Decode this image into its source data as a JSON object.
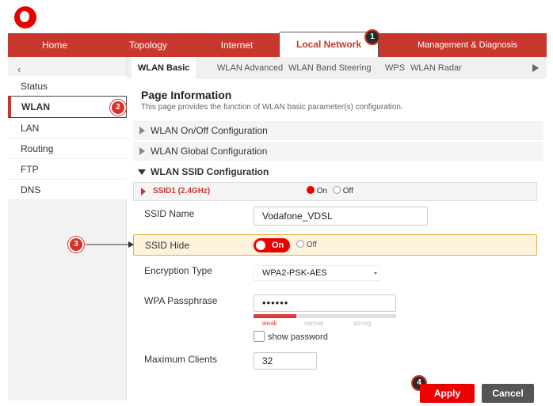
{
  "main_nav": {
    "items": [
      {
        "label": "Home"
      },
      {
        "label": "Topology"
      },
      {
        "label": "Internet"
      },
      {
        "label": "Local Network"
      },
      {
        "label": "Management & Diagnosis"
      }
    ],
    "active": "Local Network"
  },
  "markers": [
    "1",
    "2",
    "3",
    "4"
  ],
  "sidebar": {
    "back": "‹",
    "items": [
      {
        "label": "Status"
      },
      {
        "label": "WLAN"
      },
      {
        "label": "LAN"
      },
      {
        "label": "Routing"
      },
      {
        "label": "FTP"
      },
      {
        "label": "DNS"
      }
    ],
    "active": "WLAN"
  },
  "sub_tabs": {
    "items": [
      {
        "label": "WLAN Basic"
      },
      {
        "label": "WLAN Advanced"
      },
      {
        "label": "WLAN Band Steering"
      },
      {
        "label": "WPS"
      },
      {
        "label": "WLAN Radar"
      }
    ],
    "active": "WLAN Basic"
  },
  "page": {
    "title": "Page Information",
    "description": "This page provides the function of WLAN basic parameter(s) configuration."
  },
  "sections": {
    "onoff": "WLAN On/Off Configuration",
    "global": "WLAN Global Configuration",
    "ssid": "WLAN SSID Configuration"
  },
  "ssid1": {
    "label": "SSID1 (2.4GHz)",
    "on_label": "On",
    "off_label": "Off",
    "selected": "On"
  },
  "form": {
    "ssid_name_label": "SSID Name",
    "ssid_name_value": "Vodafone_VDSL",
    "ssid_hide_label": "SSID Hide",
    "ssid_hide_on": "On",
    "ssid_hide_off": "Off",
    "encryption_label": "Encryption Type",
    "encryption_value": "WPA2-PSK-AES",
    "passphrase_label": "WPA Passphrase",
    "passphrase_value": "••••••",
    "strength_labels": [
      "weak",
      "normal",
      "strong"
    ],
    "strength_level": 0.3,
    "show_password_label": "show password",
    "max_clients_label": "Maximum Clients",
    "max_clients_value": "32"
  },
  "buttons": {
    "apply": "Apply",
    "cancel": "Cancel"
  },
  "colors": {
    "brand_red": "#c8372d",
    "accent_red": "#e00000",
    "highlight_bg": "#fdf3dc",
    "highlight_border": "#e2b13c"
  }
}
